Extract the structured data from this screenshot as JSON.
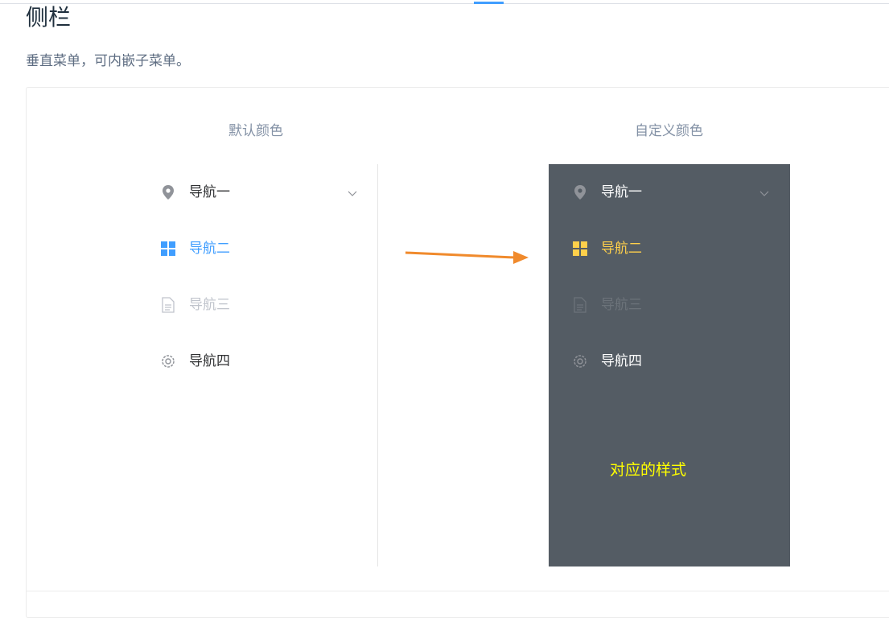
{
  "page": {
    "title": "侧栏",
    "description": "垂直菜单，可内嵌子菜单。"
  },
  "demo": {
    "left_title": "默认颜色",
    "right_title": "自定义颜色",
    "annotation": "对应的样式",
    "default_menu": {
      "background": "#ffffff",
      "text_color": "#303133",
      "active_color": "#409eff",
      "items": [
        {
          "label": "导航一",
          "icon": "location-icon",
          "has_submenu": true
        },
        {
          "label": "导航二",
          "icon": "menu-grid-icon",
          "active": true
        },
        {
          "label": "导航三",
          "icon": "document-icon",
          "disabled": true
        },
        {
          "label": "导航四",
          "icon": "setting-icon"
        }
      ]
    },
    "custom_menu": {
      "background": "#545c64",
      "text_color": "#ffffff",
      "active_color": "#ffd04b",
      "items": [
        {
          "label": "导航一",
          "icon": "location-icon",
          "has_submenu": true
        },
        {
          "label": "导航二",
          "icon": "menu-grid-icon",
          "active": true
        },
        {
          "label": "导航三",
          "icon": "document-icon",
          "disabled": true
        },
        {
          "label": "导航四",
          "icon": "setting-icon"
        }
      ]
    },
    "arrow_color": "#f08a2c",
    "annotation_color": "#ffff00"
  }
}
